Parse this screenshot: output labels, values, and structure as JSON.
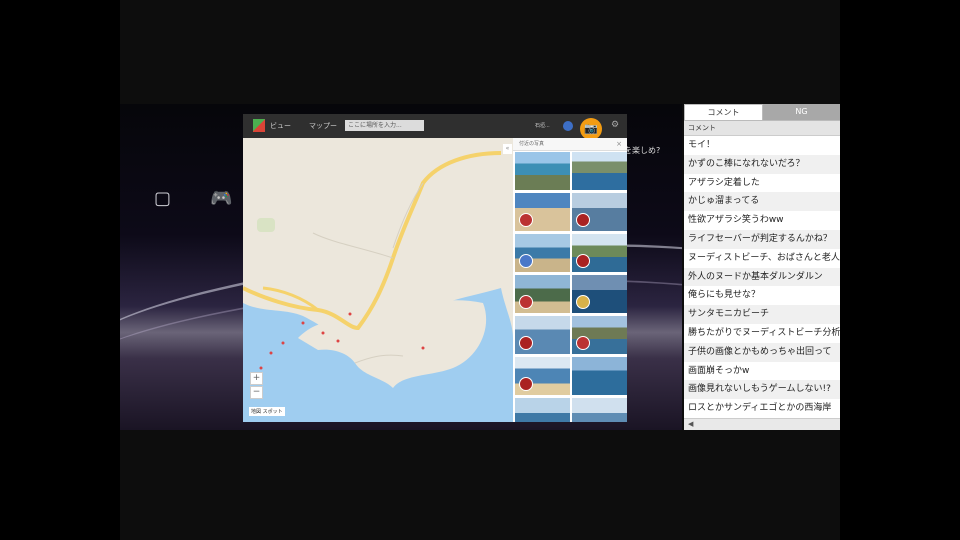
{
  "maps": {
    "tab1": "ビュー",
    "tab2": "マップー",
    "search_placeholder": "ここに場所を入力...",
    "user_name": "石垣...",
    "photo_panel_header": "付近の写真",
    "close_glyph": "×",
    "collapse_glyph": "«",
    "zoom_in": "+",
    "zoom_out": "−",
    "map_label": "地図  スポット",
    "camera_glyph": "📷",
    "gear_glyph": "⚙",
    "accent": "#f39c12"
  },
  "ps_overlay": {
    "cut_text": "を楽しめ?",
    "icon1": "▢",
    "icon2": "🎮"
  },
  "comments": {
    "tab_comment": "コメント",
    "tab_ng": "NG",
    "header": "コメント",
    "scroll_arrow": "◀",
    "items": [
      "モイ！",
      "かずのこ棒になれないだろ？",
      "アザラシ定着した",
      "かじゅ溜まってる",
      "性欲アザラシ笑うわww",
      "ライフセーバーが判定するんかね？",
      "ヌーディストビーチ、おばさんと老人",
      "外人のヌードか基本ダルンダルン",
      "俺らにも見せな？",
      "サンタモニカビーチ",
      "勝ちたがりでヌーディストビーチ分析",
      "子供の画像とかもめっちゃ出回って",
      "画面崩そっかw",
      "画像見れないしもうゲームしない!?",
      "ロスとかサンディエゴとかの西海岸"
    ]
  }
}
